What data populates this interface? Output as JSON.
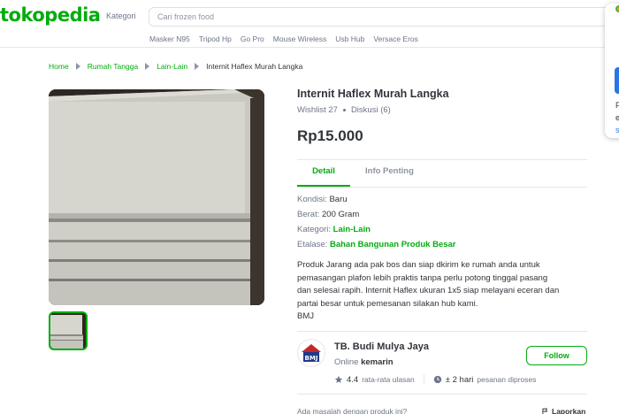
{
  "header": {
    "logo": "tokopedia",
    "kategori_label": "Kategori",
    "search_placeholder": "Cari frozen food",
    "suggestions": [
      "Masker N95",
      "Tripod Hp",
      "Go Pro",
      "Mouse Wireless",
      "Usb Hub",
      "Versace Eros"
    ]
  },
  "popup": {
    "line1": "F",
    "line2": "e",
    "link": "s"
  },
  "breadcrumb": [
    "Home",
    "Rumah Tangga",
    "Lain-Lain",
    "Internit Haflex Murah Langka"
  ],
  "product": {
    "title": "Internit Haflex Murah Langka",
    "wishlist": "Wishlist 27",
    "diskusi": "Diskusi (6)",
    "price": "Rp15.000",
    "tabs": [
      "Detail",
      "Info Penting"
    ],
    "specs": {
      "kondisi_label": "Kondisi:",
      "kondisi": "Baru",
      "berat_label": "Berat:",
      "berat": "200 Gram",
      "kategori_label": "Kategori:",
      "kategori": "Lain-Lain",
      "etalase_label": "Etalase:",
      "etalase": "Bahan Bangunan Produk Besar"
    },
    "description": [
      "Produk Jarang ada pak bos dan siap dkirim ke rumah anda untuk",
      "pemasangan plafon lebih praktis tanpa perlu potong tinggal pasang",
      "dan selesai rapih. Internit Haflex ukuran 1x5 siap melayani eceran dan",
      "partai besar untuk pemesanan silakan hub kami.",
      "BMJ"
    ]
  },
  "seller": {
    "logo_text": "BMJ",
    "name": "TB. Budi Mulya Jaya",
    "online_label": "Online",
    "online_value": "kemarin",
    "follow_label": "Follow",
    "rating": "4.4",
    "rating_label": "rata-rata ulasan",
    "process": "± 2 hari",
    "process_label": "pesanan diproses"
  },
  "footer": {
    "question": "Ada masalah dengan produk ini?",
    "report": "Laporkan"
  },
  "colors": {
    "accent": "#03ac0e",
    "text": "#31353b",
    "muted": "#6d7588"
  }
}
